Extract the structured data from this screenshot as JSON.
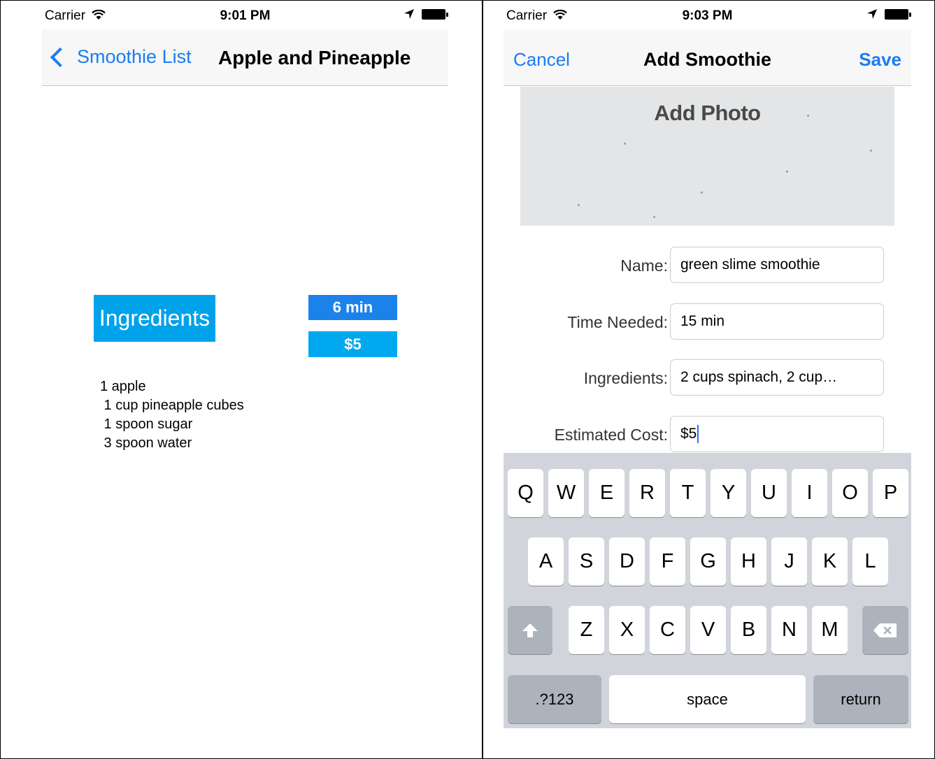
{
  "left": {
    "status": {
      "carrier": "Carrier",
      "time": "9:01 PM"
    },
    "nav": {
      "back_label": "Smoothie List",
      "title": "Apple and Pineapple"
    },
    "ingredients_label": "Ingredients",
    "time_badge": "6 min",
    "cost_badge": "$5",
    "ingredients": [
      "1 apple",
      " 1 cup pineapple cubes",
      " 1 spoon sugar",
      " 3 spoon water"
    ]
  },
  "right": {
    "status": {
      "carrier": "Carrier",
      "time": "9:03 PM"
    },
    "nav": {
      "cancel_label": "Cancel",
      "title": "Add Smoothie",
      "save_label": "Save"
    },
    "photo_label": "Add Photo",
    "form": {
      "name": {
        "label": "Name:",
        "value": "green slime smoothie"
      },
      "time": {
        "label": "Time Needed:",
        "value": "15 min"
      },
      "ingredients": {
        "label": "Ingredients:",
        "value": "2 cups spinach, 2 cup…"
      },
      "cost": {
        "label": "Estimated Cost:",
        "value": "$5"
      }
    },
    "keyboard": {
      "row1": [
        "Q",
        "W",
        "E",
        "R",
        "T",
        "Y",
        "U",
        "I",
        "O",
        "P"
      ],
      "row2": [
        "A",
        "S",
        "D",
        "F",
        "G",
        "H",
        "J",
        "K",
        "L"
      ],
      "row3": [
        "Z",
        "X",
        "C",
        "V",
        "B",
        "N",
        "M"
      ],
      "numbers_label": ".?123",
      "space_label": "space",
      "return_label": "return"
    }
  },
  "colors": {
    "ios_blue": "#1a7cf3",
    "ingredients_blue": "#00a2ea",
    "time_badge_blue": "#1b82ea",
    "cost_badge_blue": "#00a8f0",
    "keyboard_gray": "#d1d5db"
  }
}
